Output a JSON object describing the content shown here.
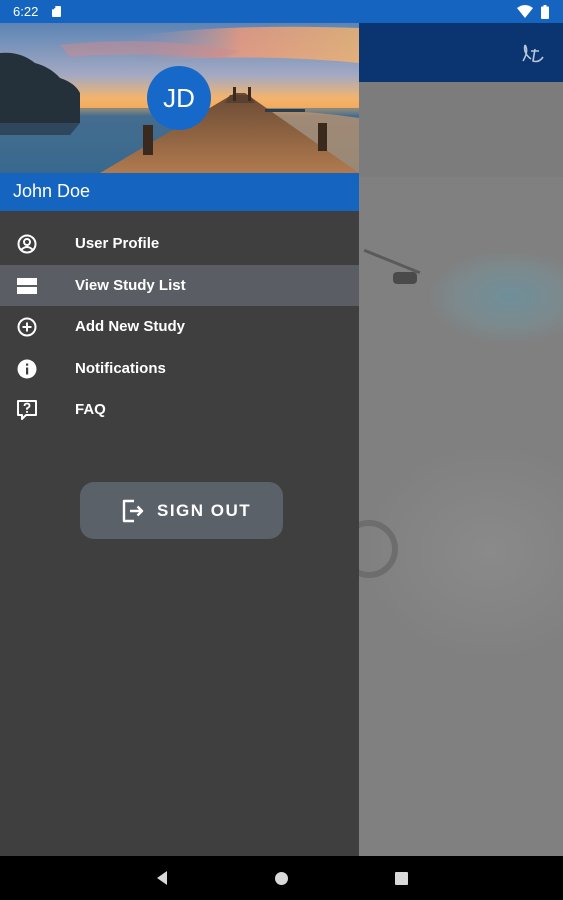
{
  "status_bar": {
    "time": "6:22"
  },
  "app_toolbar": {
    "icon": "ribbon-logo-icon"
  },
  "drawer": {
    "avatar_initials": "JD",
    "user_name": "John Doe",
    "menu": [
      {
        "label": "User Profile",
        "icon": "account-circle-icon",
        "active": false
      },
      {
        "label": "View Study List",
        "icon": "list-view-icon",
        "active": true
      },
      {
        "label": "Add New Study",
        "icon": "add-circle-icon",
        "active": false
      },
      {
        "label": "Notifications",
        "icon": "info-icon",
        "active": false
      },
      {
        "label": "FAQ",
        "icon": "help-chat-icon",
        "active": false
      }
    ],
    "sign_out_label": "SIGN OUT"
  },
  "colors": {
    "status_bar": "#1565c0",
    "name_bar": "#1565c0",
    "avatar": "#1669c8",
    "drawer_bg": "#3f3f3f",
    "active_item": "#5a5e64",
    "sign_out_button": "#5b6169",
    "app_toolbar": "#0a3570"
  }
}
